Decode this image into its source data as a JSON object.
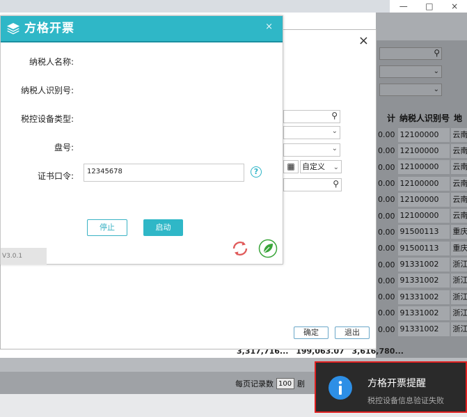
{
  "main_dialog": {
    "title": "方格开票",
    "close_symbol": "×",
    "labels": {
      "taxpayer_name": "纳税人名称:",
      "taxpayer_id": "纳税人识别号:",
      "device_type": "税控设备类型:",
      "disk_no": "盘号:",
      "cert_password": "证书口令:"
    },
    "cert_password_value": "12345678",
    "help_symbol": "?",
    "stop_button": "停止",
    "start_button": "启动",
    "version_text": "V3.0.1"
  },
  "mid_dialog": {
    "close_symbol": "×",
    "date_option": "自定义",
    "confirm_button": "确定",
    "exit_button": "退出"
  },
  "table": {
    "headers": [
      "计",
      "纳税人识别号",
      "地"
    ],
    "rows": [
      {
        "sum": "0.00",
        "taxid": "12100000",
        "region": "云南"
      },
      {
        "sum": "0.00",
        "taxid": "12100000",
        "region": "云南"
      },
      {
        "sum": "0.00",
        "taxid": "12100000",
        "region": "云南"
      },
      {
        "sum": "0.00",
        "taxid": "12100000",
        "region": "云南"
      },
      {
        "sum": "0.00",
        "taxid": "12100000",
        "region": "云南"
      },
      {
        "sum": "0.00",
        "taxid": "12100000",
        "region": "云南"
      },
      {
        "sum": "0.00",
        "taxid": "91500113",
        "region": "重庆"
      },
      {
        "sum": "0.00",
        "taxid": "91500113",
        "region": "重庆"
      },
      {
        "sum": "0.00",
        "taxid": "91331002",
        "region": "浙江"
      },
      {
        "sum": "0.00",
        "taxid": "91331002",
        "region": "浙江"
      },
      {
        "sum": "0.00",
        "taxid": "91331002",
        "region": "浙江"
      },
      {
        "sum": "0.00",
        "taxid": "91331002",
        "region": "浙江"
      },
      {
        "sum": "0.00",
        "taxid": "91331002",
        "region": "浙江"
      }
    ],
    "totals": [
      "3,317,716...",
      "199,063.07",
      "3,616,780..."
    ]
  },
  "footer": {
    "per_page_label": "每页记录数",
    "per_page_value": "100",
    "page_label": "剧"
  },
  "window_controls": [
    "—",
    "□",
    "×"
  ],
  "toast": {
    "title": "方格开票提醒",
    "message": "税控设备信息验证失败"
  }
}
